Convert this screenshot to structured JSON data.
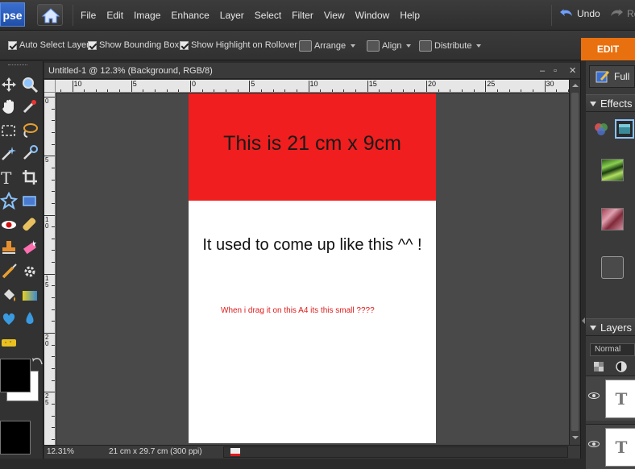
{
  "app": {
    "logo": "pse"
  },
  "menu": [
    "File",
    "Edit",
    "Image",
    "Enhance",
    "Layer",
    "Select",
    "Filter",
    "View",
    "Window",
    "Help"
  ],
  "history": {
    "undo": "Undo",
    "redo": "Re"
  },
  "options": {
    "auto_select_layer": "Auto Select Layer",
    "show_bounding_box": "Show Bounding Box",
    "show_highlight": "Show Highlight on Rollover",
    "arrange": "Arrange",
    "align": "Align",
    "distribute": "Distribute"
  },
  "mode_tab": "EDIT",
  "document": {
    "title": "Untitled-1 @ 12.3% (Background, RGB/8)",
    "ruler_h_labels": [
      "10",
      "5",
      "0",
      "5",
      "10",
      "15",
      "20",
      "25",
      "30"
    ],
    "ruler_v_labels": [
      "0",
      "5",
      "1 0",
      "1 5",
      "2 0",
      "2 5"
    ],
    "red_text": "This is 21 cm x 9cm",
    "black_text": "It used to come up like this ^^ !",
    "small_text": "When i drag it on this A4 its this small ????"
  },
  "status": {
    "zoom": "12.31%",
    "doc_size": "21 cm x 29.7 cm (300 ppi)"
  },
  "panels": {
    "full_tab": "Full",
    "effects_title": "Effects",
    "layers_title": "Layers",
    "blend_mode": "Normal",
    "layer_thumb_glyph": "T"
  },
  "colors": {
    "foreground": "#000000",
    "background": "#ffffff",
    "accent": "#e8700f",
    "red_band": "#f01e1e"
  }
}
